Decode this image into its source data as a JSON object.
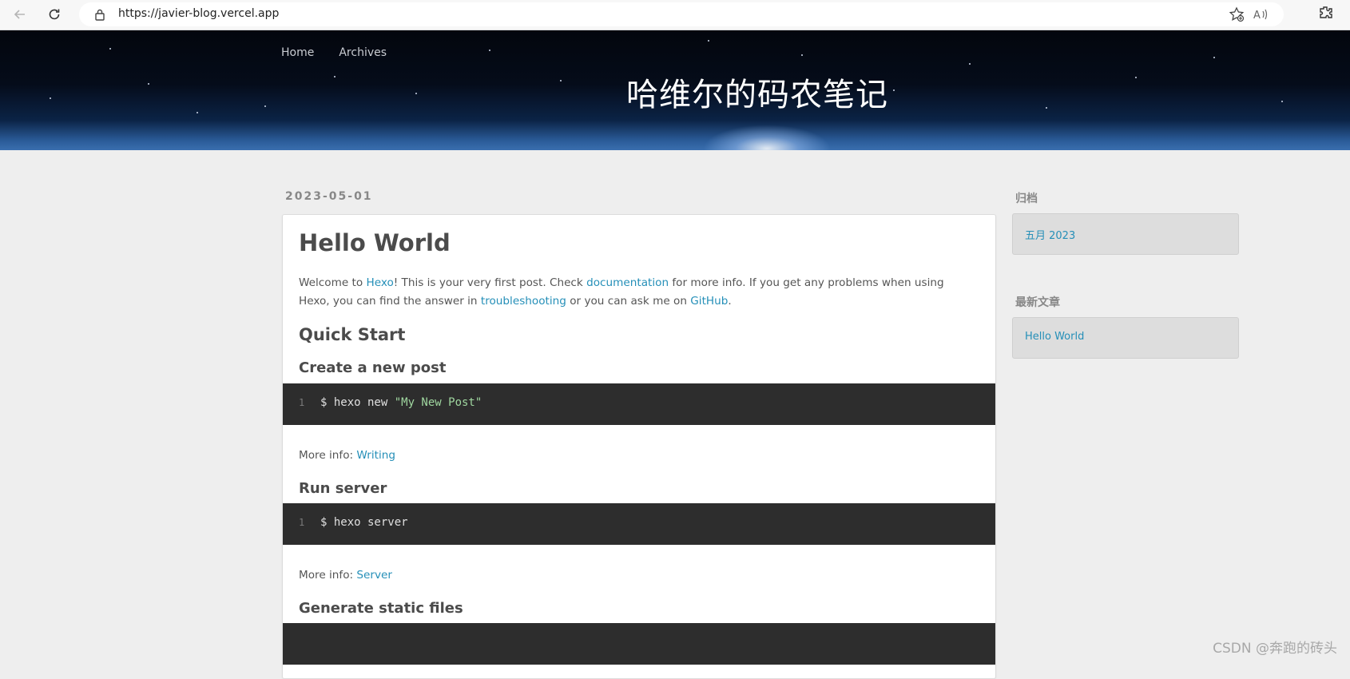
{
  "browser": {
    "url": "https://javier-blog.vercel.app",
    "icons": [
      "back-arrow-icon",
      "refresh-icon",
      "lock-icon",
      "read-aloud-icon",
      "favorites-icon",
      "extensions-icon"
    ]
  },
  "site": {
    "title": "哈维尔的码农笔记",
    "nav": [
      "Home",
      "Archives"
    ]
  },
  "post": {
    "date": "2023-05-01",
    "title": "Hello World",
    "intro": {
      "p1": "Welcome to ",
      "hexo": "Hexo",
      "p2": "! This is your very first post. Check ",
      "documentation": "documentation",
      "p3": " for more info. If you get any problems when using Hexo, you can find the answer in ",
      "troubleshooting": "troubleshooting",
      "p4": " or you can ask me on ",
      "github": "GitHub",
      "p5": "."
    },
    "quick_start": "Quick Start",
    "sections": [
      {
        "heading": "Create a new post",
        "line_no": "1",
        "code_cmd": "$ hexo new ",
        "code_str": "\"My New Post\"",
        "more_label": "More info: ",
        "more_link": "Writing"
      },
      {
        "heading": "Run server",
        "line_no": "1",
        "code_cmd": "$ hexo server",
        "more_label": "More info: ",
        "more_link": "Server"
      },
      {
        "heading": "Generate static files"
      }
    ]
  },
  "sidebar": {
    "archive_title": "归档",
    "archive_item": "五月 2023",
    "recent_title": "最新文章",
    "recent_item": "Hello World"
  },
  "watermark": "CSDN @奔跑的砖头",
  "colors": {
    "link": "#258fb8",
    "code_bg": "#2d2d2d",
    "page_bg": "#eeeeee"
  }
}
